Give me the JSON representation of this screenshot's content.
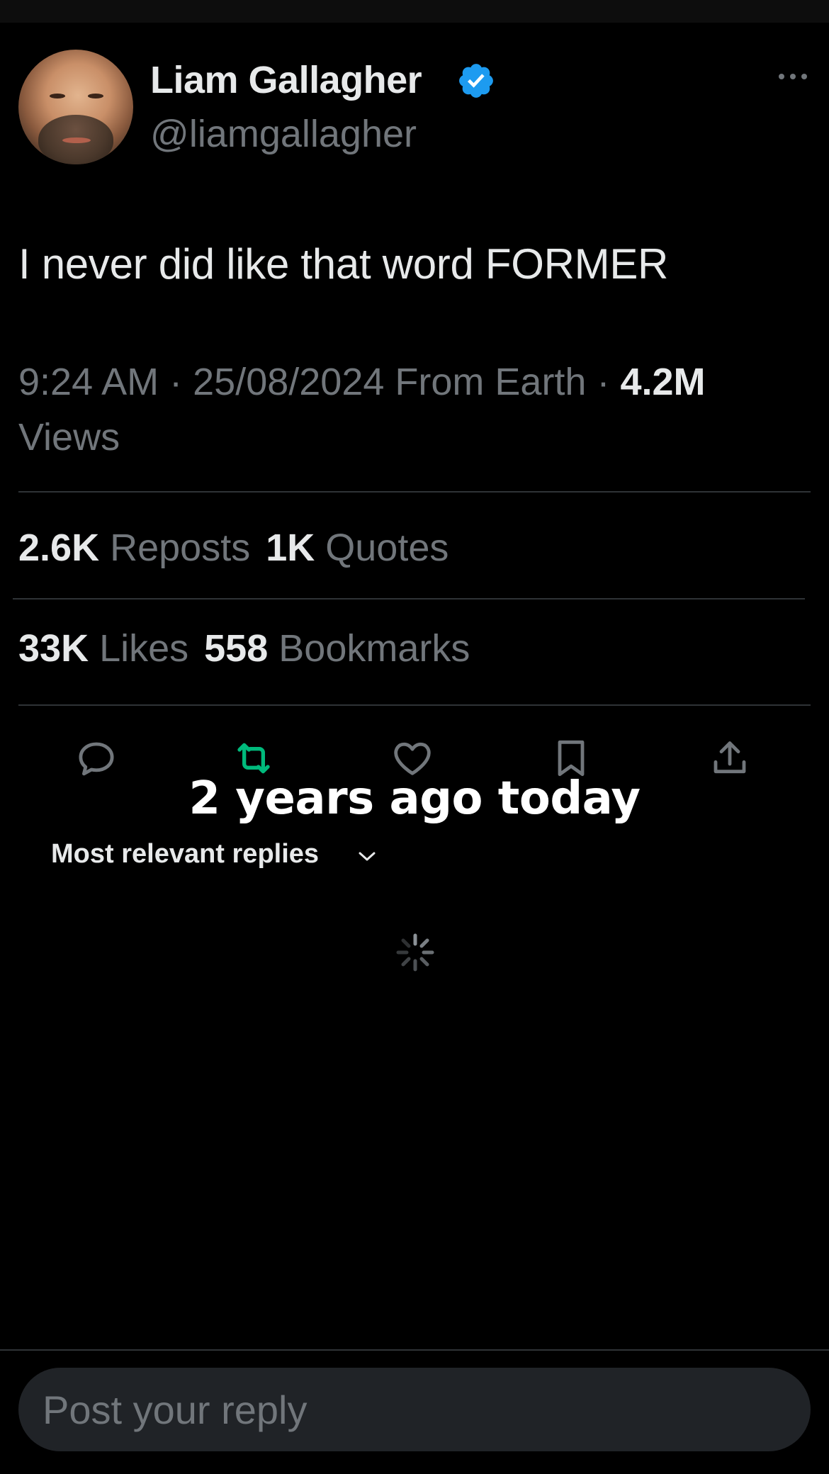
{
  "author": {
    "name": "Liam Gallagher",
    "handle": "@liamgallagher",
    "verified": true,
    "verified_color": "#1d9bf0"
  },
  "tweet": {
    "text": "I never did like that word FORMER",
    "time": "9:24 AM",
    "date": "25/08/2024",
    "location": "From Earth",
    "views_count": "4.2M",
    "views_label": "Views"
  },
  "stats": {
    "reposts_count": "2.6K",
    "reposts_label": "Reposts",
    "quotes_count": "1K",
    "quotes_label": "Quotes",
    "likes_count": "33K",
    "likes_label": "Likes",
    "bookmarks_count": "558",
    "bookmarks_label": "Bookmarks"
  },
  "actions": {
    "icons": [
      "reply-icon",
      "repost-icon",
      "like-icon",
      "bookmark-icon",
      "share-icon"
    ],
    "repost_active_color": "#00ba7c"
  },
  "overlay_caption": "2 years ago today",
  "replies": {
    "sort_label": "Most relevant replies"
  },
  "composer": {
    "placeholder": "Post your reply"
  },
  "colors": {
    "background": "#000000",
    "primary_text": "#e7e9ea",
    "secondary_text": "#71767b",
    "divider": "#2f3336"
  }
}
